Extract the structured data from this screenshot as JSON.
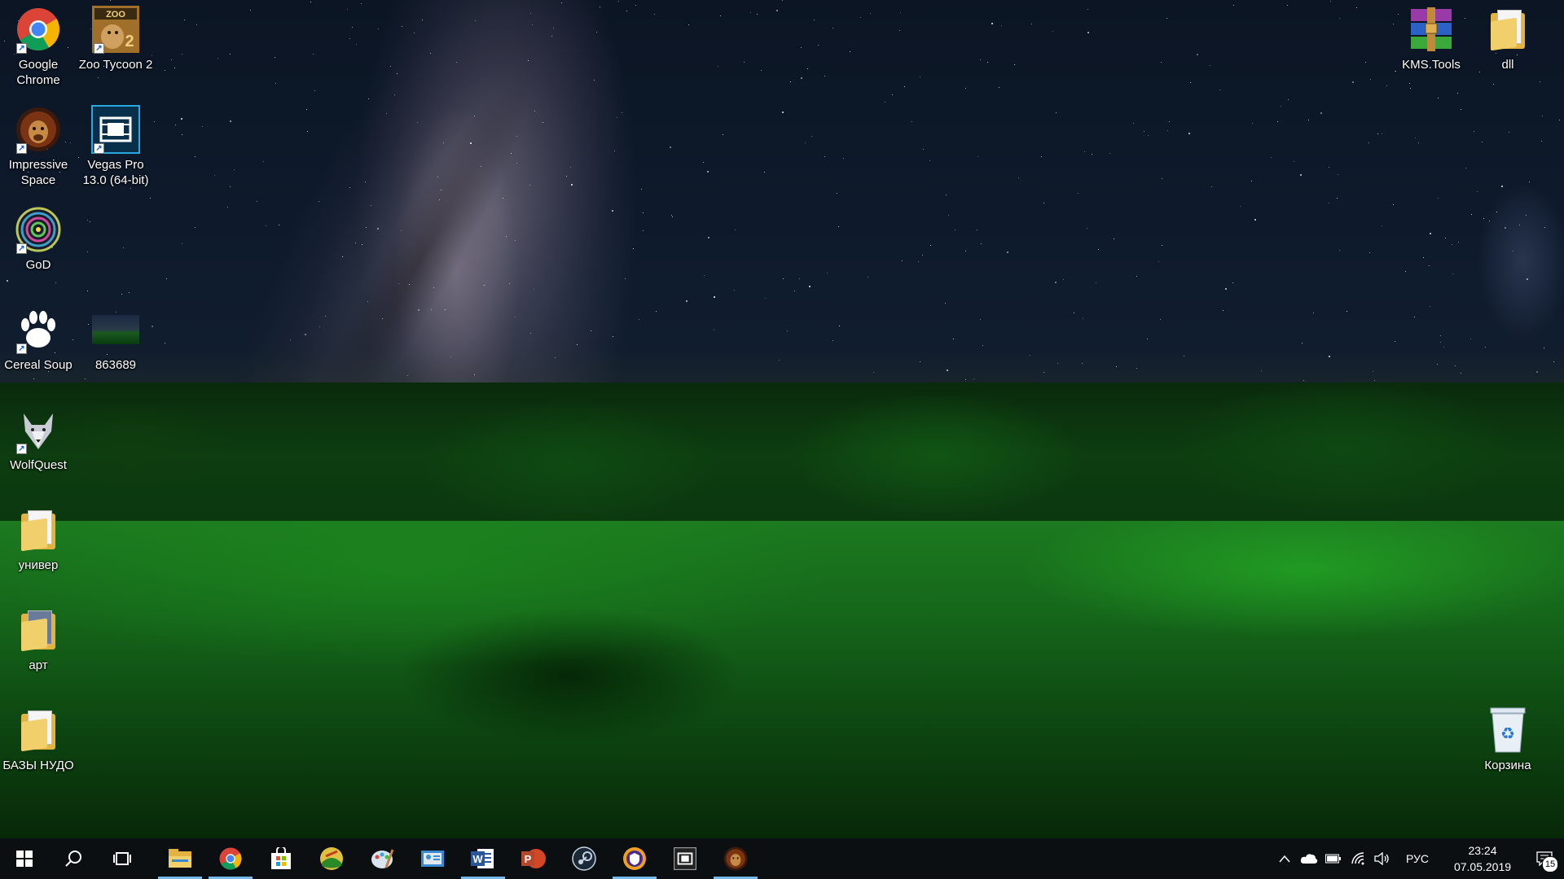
{
  "desktop": {
    "left_icons": [
      {
        "label": "Google Chrome",
        "icon": "chrome-icon"
      },
      {
        "label": "Zoo Tycoon 2",
        "icon": "zoo-tycoon-icon"
      },
      {
        "label": "Impressive Space",
        "icon": "lion-icon"
      },
      {
        "label": "Vegas Pro 13.0 (64-bit)",
        "icon": "film-strip-icon"
      },
      {
        "label": "GoD",
        "icon": "spiral-icon"
      },
      {
        "label": "Cereal Soup",
        "icon": "paw-icon"
      },
      {
        "label": "863689",
        "icon": "image-file-icon"
      },
      {
        "label": "WolfQuest",
        "icon": "wolf-icon"
      },
      {
        "label": "универ",
        "icon": "folder-icon"
      },
      {
        "label": "арт",
        "icon": "folder-icon"
      },
      {
        "label": "БАЗЫ НУДО",
        "icon": "folder-icon"
      }
    ],
    "right_icons": [
      {
        "label": "KMS.Tools",
        "icon": "winrar-icon"
      },
      {
        "label": "dll",
        "icon": "folder-icon"
      },
      {
        "label": "Корзина",
        "icon": "recycle-bin-icon"
      }
    ]
  },
  "taskbar": {
    "pinned": [
      {
        "name": "file-explorer",
        "running": true
      },
      {
        "name": "chrome",
        "running": true
      },
      {
        "name": "microsoft-store",
        "running": false
      },
      {
        "name": "landscape-app",
        "running": false
      },
      {
        "name": "paint-app",
        "running": false
      },
      {
        "name": "contacts-app",
        "running": false
      },
      {
        "name": "word",
        "running": true
      },
      {
        "name": "powerpoint",
        "running": false
      },
      {
        "name": "steam",
        "running": false
      },
      {
        "name": "security-app",
        "running": true
      },
      {
        "name": "vegas-pro",
        "running": false
      },
      {
        "name": "impressive-space",
        "running": true
      }
    ],
    "tray": {
      "language": "РУС",
      "time": "23:24",
      "date": "07.05.2019",
      "notification_count": "15"
    }
  },
  "colors": {
    "taskbar_bg": "#0c0f12",
    "running_indicator": "#76b9ed",
    "icon_label": "#ffffff"
  }
}
